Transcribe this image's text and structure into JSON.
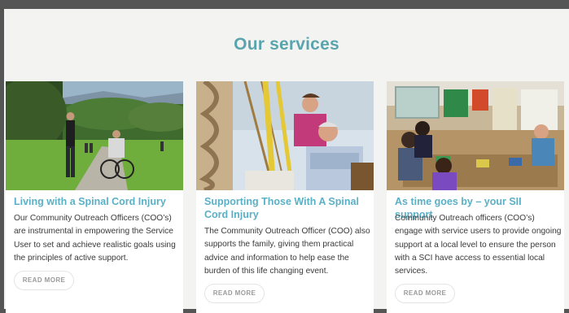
{
  "page": {
    "title": "Our services"
  },
  "cards": [
    {
      "title": "Living with a Spinal Cord Injury",
      "text": "Our Community Outreach Officers (COO’s) are instrumental in empowering the Service User to set and achieve realistic goals using the principles of active support.",
      "button": "READ MORE"
    },
    {
      "title": "Supporting Those With A Spinal Cord Injury",
      "text": "The Community Outreach Officer (COO) also supports the family, giving them practical advice and information to help ease the burden of this life changing event.",
      "button": "READ MORE"
    },
    {
      "title": "As time goes by – your SII support",
      "text": "Community Outreach officers (COO’s) engage with service users to provide ongoing support at a local level to ensure the person with a SCI have access to essential local services.",
      "button": "READ MORE"
    }
  ],
  "colors": {
    "accent": "#5aa5ad",
    "card_title": "#5ab0c6",
    "background": "#f3f3f1",
    "frame": "#555555"
  }
}
